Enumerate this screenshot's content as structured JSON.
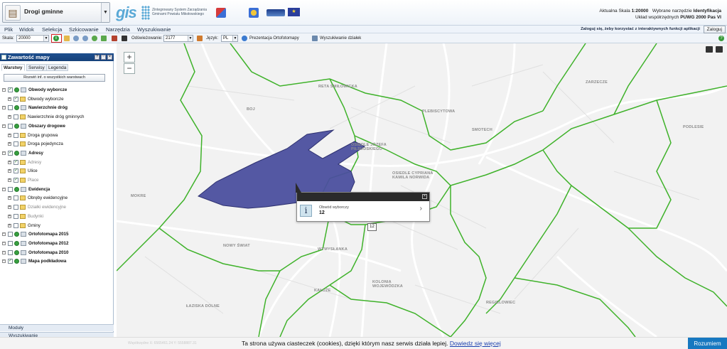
{
  "header": {
    "app_name": "Drogi gminne",
    "app_icon": "road-app-icon",
    "brand_word": "gis",
    "brand_tagline": "Zintegrowany System Zarządzania Gminami Powiatu Mikołowskiego",
    "logos": [
      "program-regionalny-logo",
      "slaskie-logo",
      "fundusz-logo",
      "eu-flag-logo"
    ],
    "scale_label": "Aktualna Skala",
    "scale_value": "1:20000",
    "tool_label": "Wybrane narzędzie",
    "tool_value": "Identyfikacja",
    "crs_label": "Układ współrzędnych",
    "crs_value": "PUWG 2000 Pas VI"
  },
  "menu": {
    "items": [
      "Plik",
      "Widok",
      "Selekcja",
      "Szkicowanie",
      "Narzędzia",
      "Wyszukiwanie"
    ],
    "login_message": "Zaloguj się, żeby korzystać z interaktywnych funkcji aplikacji",
    "login_button": "Zaloguj"
  },
  "toolbar": {
    "scale_label": "Skala:",
    "scale_value": "20000",
    "refresh_label": "Odświeżowanie:",
    "refresh_value": "2177",
    "lang_label": "Język:",
    "lang_value": "PL",
    "ortho_label": "Prezentacja Ortofotomapy",
    "parcel_label": "Wyszukiwanie działek"
  },
  "panel": {
    "title": "Zawartość mapy",
    "tabs": [
      "Warstwy",
      "Serwisy",
      "Legenda"
    ],
    "active_tab": "Warstwy",
    "button_all": "Rozwiń inf. o wszystkich warstwach",
    "layers": [
      {
        "label": "Obwody wyborcze",
        "group": true,
        "checked": true,
        "dim": false
      },
      {
        "label": "Obwody wyborcze",
        "group": false,
        "checked": true,
        "dim": false
      },
      {
        "label": "Nawierzchnie dróg",
        "group": true,
        "checked": false,
        "dim": false
      },
      {
        "label": "Nawierzchnie dróg gminnych",
        "group": false,
        "checked": false,
        "dim": false
      },
      {
        "label": "Obszary drogowe",
        "group": true,
        "checked": false,
        "dim": false
      },
      {
        "label": "Droga grupowa",
        "group": false,
        "checked": false,
        "dim": false
      },
      {
        "label": "Droga pojedyncza",
        "group": false,
        "checked": false,
        "dim": false
      },
      {
        "label": "Adresy",
        "group": true,
        "checked": true,
        "dim": false
      },
      {
        "label": "Adresy",
        "group": false,
        "checked": true,
        "dim": true
      },
      {
        "label": "Ulice",
        "group": false,
        "checked": true,
        "dim": false
      },
      {
        "label": "Place",
        "group": false,
        "checked": true,
        "dim": true
      },
      {
        "label": "Ewidencja",
        "group": true,
        "checked": false,
        "dim": false
      },
      {
        "label": "Obręby ewidencyjne",
        "group": false,
        "checked": false,
        "dim": false
      },
      {
        "label": "Działki ewidencyjne",
        "group": false,
        "checked": false,
        "dim": true
      },
      {
        "label": "Budynki",
        "group": false,
        "checked": false,
        "dim": true
      },
      {
        "label": "Gminy",
        "group": false,
        "checked": false,
        "dim": false
      },
      {
        "label": "Ortofotomapa 2015",
        "group": true,
        "checked": false,
        "dim": false
      },
      {
        "label": "Ortofotomapa 2012",
        "group": true,
        "checked": false,
        "dim": false
      },
      {
        "label": "Ortofotomapa 2010",
        "group": true,
        "checked": false,
        "dim": false
      },
      {
        "label": "Mapa podkładowa",
        "group": true,
        "checked": true,
        "dim": false
      }
    ],
    "bottom": [
      "Moduły",
      "Wyszukiwanie"
    ]
  },
  "map": {
    "zoom_in": "+",
    "zoom_out": "−",
    "labels": [
      "RETA ŚMIŁOWICKA",
      "BOJ",
      "OSIEDLE JÓZEFA PIŁSUDSKIEGO",
      "OSIEDLE CYPRIANA KAMILA NORWIDA",
      "PLEBISCYTOWA",
      "SMOTECH",
      "ZARZECZE",
      "PODLESIE",
      "MOKRE",
      "NOWY ŚWIAT",
      "WYMYSŁANKA",
      "KOLONIA WOJEWÓDZKA",
      "KAŁUŻE",
      "ŁAZISKA DOLNE",
      "REGIELOWIEC"
    ],
    "popup_label": "Obwód wyborczy",
    "popup_value": "12",
    "polygon_tag": "12",
    "polygon_color": "#4b4f9e",
    "boundary_color": "#3fb22a"
  },
  "cookie": {
    "text": "Ta strona używa ciasteczek (cookies), dzięki którym nasz serwis działa lepiej.",
    "link": "Dowiedz się więcej",
    "button": "Rozumiem",
    "coords": "Współrzędne X: 6565461.24 Y: 5558887.31"
  },
  "colors": {
    "panel_header": "#1e4f8f",
    "cookie_button": "#1778c0",
    "info_tool_highlight": "#d42020"
  }
}
